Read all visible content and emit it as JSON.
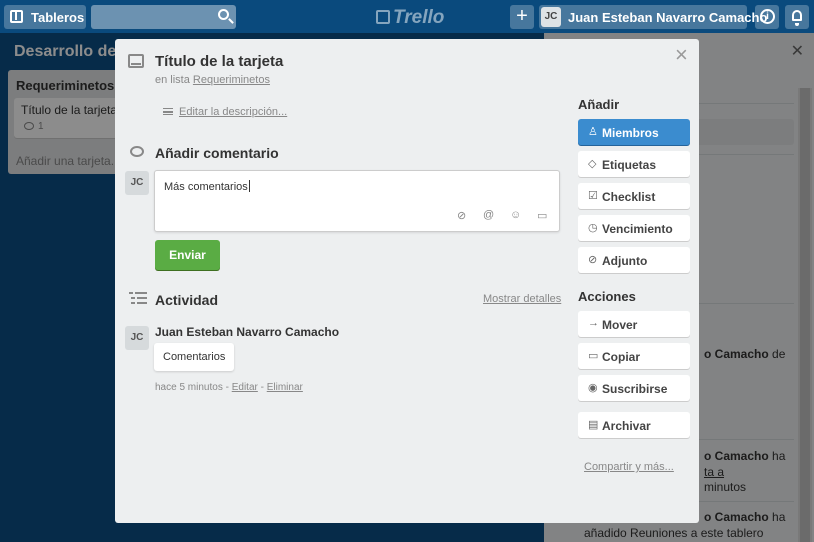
{
  "header": {
    "boards_label": "Tableros",
    "logo_text": "Trello",
    "add_label": "+",
    "user_initials": "JC",
    "user_name": "Juan Esteban Navarro Camacho",
    "info_label": "i"
  },
  "board": {
    "title": "Desarrollo del",
    "list": {
      "name": "Requeriminetos",
      "card": {
        "title": "Título de la tarjeta",
        "comment_count": "1"
      },
      "add_card": "Añadir una tarjeta..."
    }
  },
  "sidebar_activity": [
    {
      "user": "o Camacho",
      "rest": " de"
    },
    {
      "user": "o Camacho",
      "rest": " ha"
    },
    {
      "user": "",
      "rest": "ta a"
    },
    {
      "user": "",
      "rest": "minutos"
    },
    {
      "user": "o Camacho",
      "rest": " ha"
    },
    {
      "user": "",
      "rest": "añadido Reuniones a este tablero"
    }
  ],
  "modal": {
    "close": "×",
    "title": "Título de la tarjeta",
    "in_list_prefix": "en lista ",
    "in_list_name": "Requeriminetos",
    "edit_description": "Editar la descripción...",
    "comment_heading": "Añadir comentario",
    "avatar_initials": "JC",
    "comment_text": "Más comentarios",
    "send_button": "Enviar",
    "activity_heading": "Actividad",
    "show_details": "Mostrar detalles",
    "activity": {
      "user": "Juan Esteban Navarro Camacho",
      "comment": "Comentarios",
      "time": "hace 5 minutos",
      "sep": " - ",
      "edit": "Editar",
      "delete": "Eliminar"
    },
    "add_heading": "Añadir",
    "add_buttons": [
      "Miembros",
      "Etiquetas",
      "Checklist",
      "Vencimiento",
      "Adjunto"
    ],
    "actions_heading": "Acciones",
    "action_buttons": [
      "Mover",
      "Copiar",
      "Suscribirse",
      "Archivar"
    ],
    "share_link": "Compartir y más..."
  }
}
